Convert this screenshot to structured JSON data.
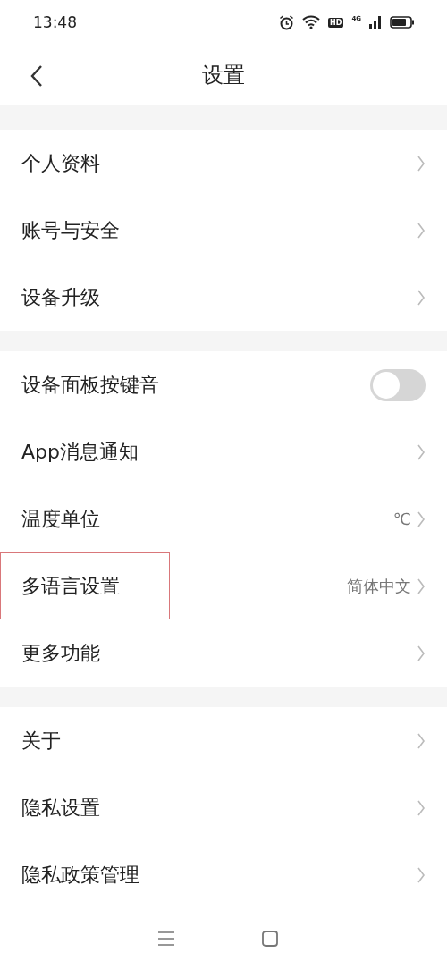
{
  "status_bar": {
    "time": "13:48",
    "hd_badge": "HD",
    "network": "4G"
  },
  "header": {
    "title": "设置"
  },
  "groups": [
    {
      "items": [
        {
          "kind": "link",
          "label": "个人资料",
          "highlighted": false
        },
        {
          "kind": "link",
          "label": "账号与安全",
          "highlighted": false
        },
        {
          "kind": "link",
          "label": "设备升级",
          "highlighted": false
        }
      ]
    },
    {
      "items": [
        {
          "kind": "toggle",
          "label": "设备面板按键音",
          "on": false,
          "highlighted": false
        },
        {
          "kind": "link",
          "label": "App消息通知",
          "highlighted": false
        },
        {
          "kind": "link",
          "label": "温度单位",
          "value": "℃",
          "highlighted": false
        },
        {
          "kind": "link",
          "label": "多语言设置",
          "value": "简体中文",
          "highlighted": true
        },
        {
          "kind": "link",
          "label": "更多功能",
          "highlighted": false
        }
      ]
    },
    {
      "items": [
        {
          "kind": "link",
          "label": "关于",
          "highlighted": false
        },
        {
          "kind": "link",
          "label": "隐私设置",
          "highlighted": false
        },
        {
          "kind": "link",
          "label": "隐私政策管理",
          "highlighted": false
        }
      ]
    }
  ]
}
